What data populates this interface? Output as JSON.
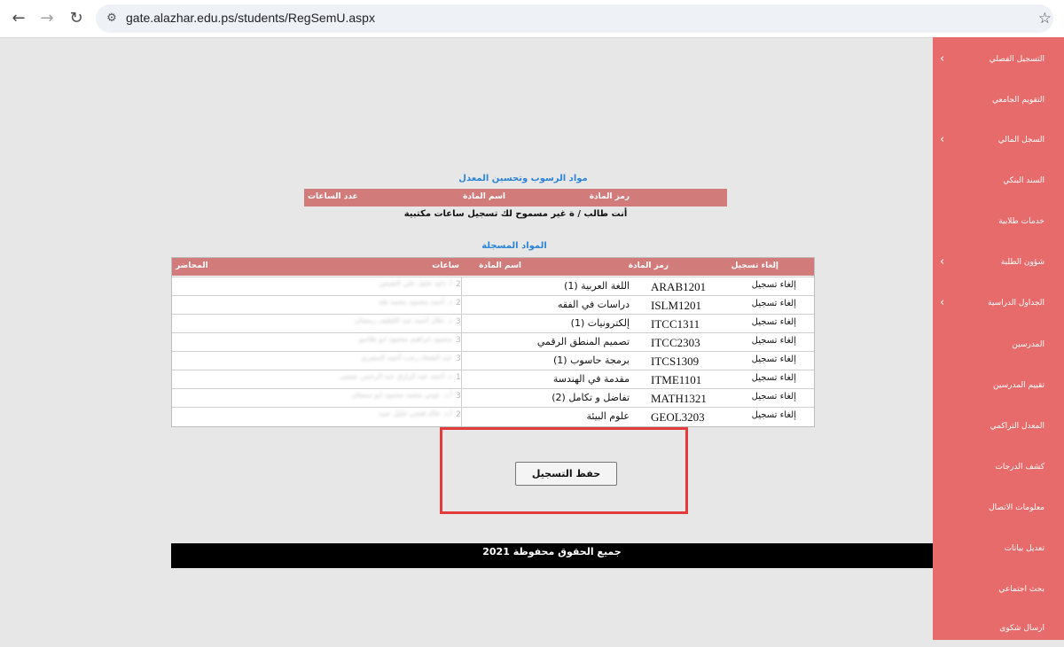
{
  "browser": {
    "url": "gate.alazhar.edu.ps/students/RegSemU.aspx",
    "back_icon": "←",
    "forward_icon": "→",
    "reload_icon": "↻",
    "star_icon": "☆"
  },
  "sidebar": {
    "items": [
      {
        "label": "التسجيل الفصلي",
        "chevron": "‹"
      },
      {
        "label": "التقويم الجامعي",
        "chevron": ""
      },
      {
        "label": "السجل المالي",
        "chevron": "‹"
      },
      {
        "label": "السند البنكي",
        "chevron": ""
      },
      {
        "label": "خدمات طلابية",
        "chevron": ""
      },
      {
        "label": "شؤون الطلبة",
        "chevron": "‹"
      },
      {
        "label": "الجداول الدراسية",
        "chevron": "‹"
      },
      {
        "label": "المدرسين",
        "chevron": ""
      },
      {
        "label": "تقييم المدرسين",
        "chevron": ""
      },
      {
        "label": "المعدل التراكمي",
        "chevron": ""
      },
      {
        "label": "كشف الدرجات",
        "chevron": ""
      },
      {
        "label": "معلومات الاتصال",
        "chevron": ""
      },
      {
        "label": "تعديل بيانات",
        "chevron": ""
      },
      {
        "label": "بحث اجتماعي",
        "chevron": ""
      },
      {
        "label": "ارسال شكوى",
        "chevron": ""
      }
    ]
  },
  "failed_section": {
    "title": "مواد الرسوب وتحسين المعدل",
    "headers": {
      "code": "رمز المادة",
      "name": "اسم المادة",
      "hours": "عدد الساعات"
    },
    "notice": "أنت طالب / ة غير مسموح لك تسجيل ساعات مكتبية"
  },
  "registered_section": {
    "title": "المواد المسجلة",
    "headers": {
      "cancel": "إلغاء تسجيل",
      "code": "رمز المادة",
      "name": "اسم المادة",
      "hours": "ساعات",
      "instructor": "المحاضر"
    },
    "rows": [
      {
        "cancel": "إلغاء تسجيل",
        "code": "ARAB1201",
        "name": "اللغة العربية (1)",
        "hours": "2",
        "instructor": "أ. داود خليل علي الشيص"
      },
      {
        "cancel": "إلغاء تسجيل",
        "code": "ISLM1201",
        "name": "دراسات في الفقه",
        "hours": "2",
        "instructor": "د. أحمد محمود محمد طه"
      },
      {
        "cancel": "إلغاء تسجيل",
        "code": "ITCC1311",
        "name": "إلكترونيات (1)",
        "hours": "3",
        "instructor": "د. جلال أحمد عبد اللطيف رمضان"
      },
      {
        "cancel": "إلغاء تسجيل",
        "code": "ITCC2303",
        "name": "تصميم المنطق الرقمي",
        "hours": "3",
        "instructor": "محمود ابراهيم محمود ابو طاسو"
      },
      {
        "cancel": "إلغاء تسجيل",
        "code": "ITCS1309",
        "name": "برمجة حاسوب (1)",
        "hours": "3",
        "instructor": "عبد الشعاد رجب أحمد المصري"
      },
      {
        "cancel": "إلغاء تسجيل",
        "code": "ITME1101",
        "name": "مقدمة في الهندسة",
        "hours": "1",
        "instructor": "د. أحمد عبد الرازق عبد الرحمن عيسى"
      },
      {
        "cancel": "إلغاء تسجيل",
        "code": "MATH1321",
        "name": "تفاضل و تكامل (2)",
        "hours": "3",
        "instructor": "أ.د. عوني محمد محمود ابو سمعان"
      },
      {
        "cancel": "إلغاء تسجيل",
        "code": "GEOL3203",
        "name": "علوم البيئة",
        "hours": "2",
        "instructor": "أ.د. خالد فتحي خليل عبيد"
      }
    ]
  },
  "save_button": {
    "label": "حفظ التسجيل"
  },
  "footer": {
    "text": "جميع الحقوق محفوظة 2021"
  },
  "colors": {
    "sidebar": "#e76b6b",
    "table_header": "#d27b7b",
    "title_blue": "#2b84d6",
    "highlight_red": "#e33b3b"
  }
}
